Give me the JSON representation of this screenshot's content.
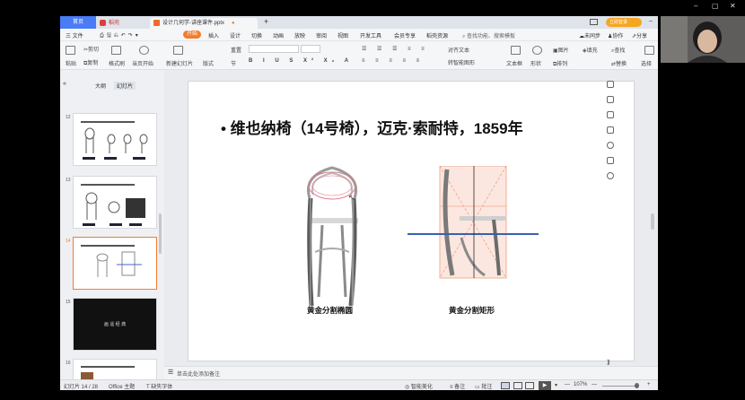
{
  "window": {
    "min": "–",
    "max": "▢",
    "close": "✕"
  },
  "tabs": {
    "home": "首页",
    "daoke": "稻壳",
    "file": "设计几何学-讲座课件.pptx",
    "add": "+"
  },
  "topright": {
    "login": "立即登录"
  },
  "menu": {
    "file": "三 文件",
    "items": [
      "开始",
      "插入",
      "设计",
      "切换",
      "动画",
      "放映",
      "审阅",
      "视图",
      "开发工具",
      "会员专享",
      "稻壳资源"
    ],
    "search": "查找功能、搜索模板",
    "sync": "未同步",
    "collab": "协作",
    "share": "分享"
  },
  "ribbon": {
    "paste": "粘贴",
    "cut": "剪切",
    "copy": "复制",
    "format_painter": "格式刷",
    "from_current": "当页开始",
    "new_slide": "新建幻灯片",
    "layout": "版式",
    "section": "节",
    "reset": "重置",
    "text_box": "文本框",
    "shape": "形状",
    "arrange": "排列",
    "picture": "图片",
    "fill": "填充",
    "find": "查找",
    "replace": "替换",
    "select": "选择",
    "align_text": "对齐文本",
    "smart_art": "转智能图形"
  },
  "left_panel": {
    "tab_outline": "大纲",
    "tab_slides": "幻灯片",
    "slide_numbers": [
      "12",
      "13",
      "14",
      "15",
      "16"
    ],
    "slide15_text": "画 遥 经 典",
    "add": "+"
  },
  "slide": {
    "title": "• 维也纳椅（14号椅），迈克·索耐特，1859年",
    "caption_left": "黄金分割椭圆",
    "caption_right": "黄金分割矩形"
  },
  "notes": {
    "placeholder": "单击此处添加备注"
  },
  "status": {
    "slide_info": "幻灯片 14 / 28",
    "theme": "Office 主题",
    "missing_font": "缺失字体",
    "beautify": "智能美化",
    "notes": "备注",
    "comments": "批注",
    "zoom": "107%"
  }
}
